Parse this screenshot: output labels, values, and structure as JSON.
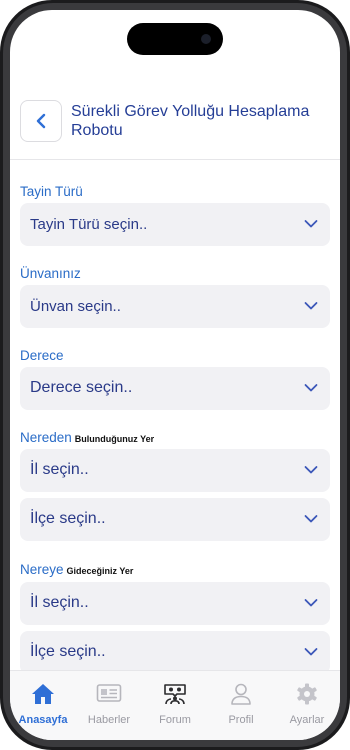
{
  "header": {
    "title": "Sürekli Görev Yolluğu Hesaplama Robotu"
  },
  "form": {
    "tayin_label": "Tayin Türü",
    "tayin_value": "Tayin Türü seçin..",
    "unvan_label": "Ünvanınız",
    "unvan_value": "Ünvan seçin..",
    "derece_label": "Derece",
    "derece_value": "Derece seçin..",
    "nereden_label": "Nereden",
    "nereden_sub": "Bulunduğunuz Yer",
    "nereden_il": "İl seçin..",
    "nereden_ilce": "İlçe seçin..",
    "nereye_label": "Nereye",
    "nereye_sub": "Gideceğiniz Yer",
    "nereye_il": "İl seçin..",
    "nereye_ilce": "İlçe seçin.."
  },
  "tabs": [
    {
      "label": "Anasayfa",
      "icon": "home-icon",
      "active": true
    },
    {
      "label": "Haberler",
      "icon": "news-icon",
      "active": false
    },
    {
      "label": "Forum",
      "icon": "forum-icon",
      "active": false
    },
    {
      "label": "Profil",
      "icon": "profile-icon",
      "active": false
    },
    {
      "label": "Ayarlar",
      "icon": "settings-icon",
      "active": false
    }
  ],
  "colors": {
    "accent": "#2f6fd6",
    "title": "#253e96",
    "field_bg": "#f1f1f4"
  }
}
